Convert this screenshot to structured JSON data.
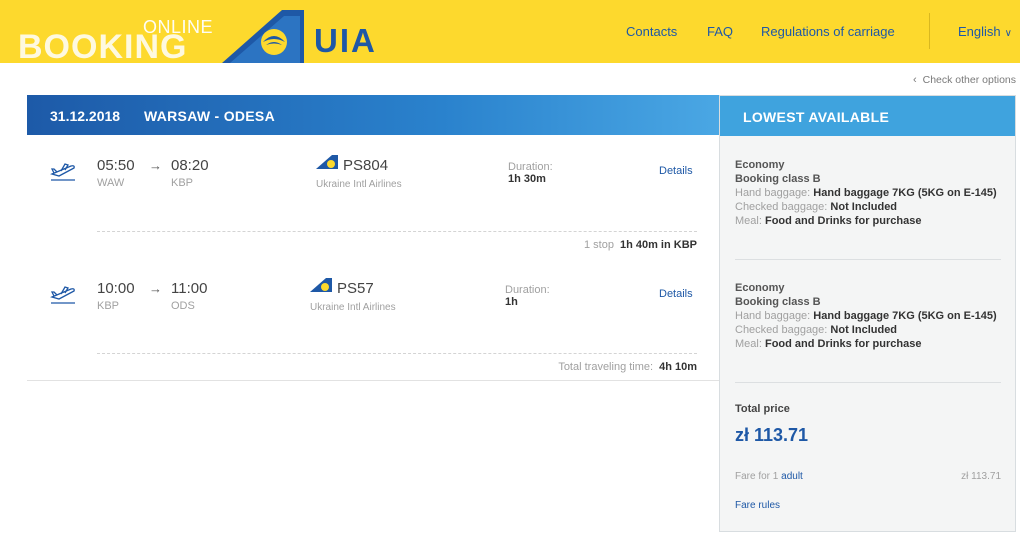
{
  "header": {
    "logo_online": "ONLINE",
    "logo_booking": "BOOKING",
    "logo_brand": "UIA",
    "nav": [
      "Contacts",
      "FAQ",
      "Regulations of carriage"
    ],
    "language": "English",
    "colors": {
      "header_bg": "#fdd92d",
      "brand_blue": "#1e58a6"
    }
  },
  "check_other": "Check other options",
  "route": {
    "date": "31.12.2018",
    "name": "WARSAW - ODESA"
  },
  "segments": [
    {
      "dep_time": "05:50",
      "arr_time": "08:20",
      "dep_code": "WAW",
      "arr_code": "KBP",
      "flight": "PS804",
      "airline": "Ukraine Intl Airlines",
      "duration_label": "Duration:",
      "duration": "1h 30m",
      "details": "Details"
    },
    {
      "dep_time": "10:00",
      "arr_time": "11:00",
      "dep_code": "KBP",
      "arr_code": "ODS",
      "flight": "PS57",
      "airline": "Ukraine Intl Airlines",
      "duration_label": "Duration:",
      "duration": "1h",
      "details": "Details"
    }
  ],
  "stop_info": {
    "label": "1 stop",
    "value": "1h 40m in KBP"
  },
  "total_travel": {
    "label": "Total traveling time:",
    "value": "4h 10m"
  },
  "panel": {
    "title": "LOWEST AVAILABLE",
    "fares": [
      {
        "cabin": "Economy",
        "booking_class": "Booking class B",
        "hand_label": "Hand baggage:",
        "hand_value": "Hand baggage 7KG (5KG on E-145)",
        "checked_label": "Checked baggage:",
        "checked_value": "Not Included",
        "meal_label": "Meal:",
        "meal_value": "Food and Drinks for purchase"
      },
      {
        "cabin": "Economy",
        "booking_class": "Booking class B",
        "hand_label": "Hand baggage:",
        "hand_value": "Hand baggage 7KG (5KG on E-145)",
        "checked_label": "Checked baggage:",
        "checked_value": "Not Included",
        "meal_label": "Meal:",
        "meal_value": "Food and Drinks for purchase"
      }
    ],
    "total_label": "Total price",
    "total_price": "zł 113.71",
    "fare_for_prefix": "Fare for 1",
    "fare_for_link": "adult",
    "fare_for_price": "zł 113.71",
    "fare_rules": "Fare rules"
  }
}
